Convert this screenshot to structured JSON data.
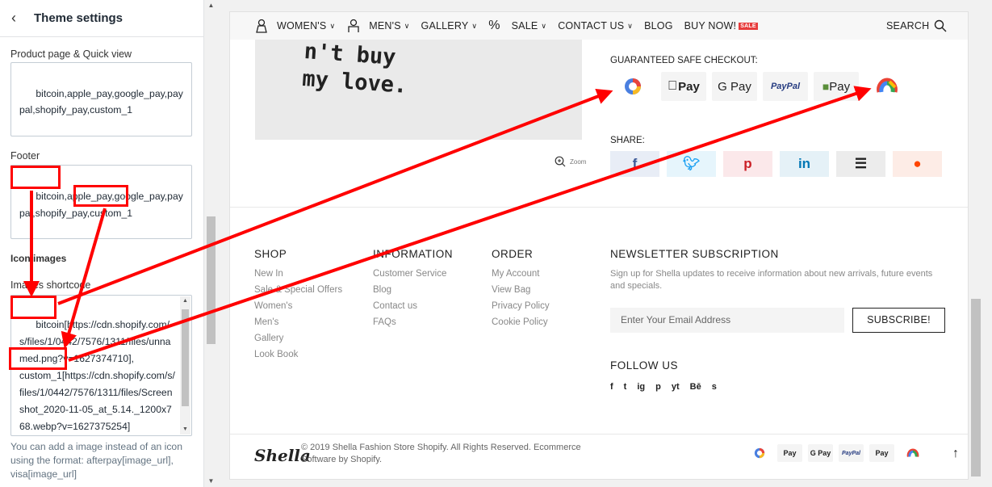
{
  "panel": {
    "back_icon": "chevron-left-icon",
    "title": "Theme settings",
    "product_label": "Product page & Quick view",
    "product_value": "bitcoin,apple_pay,google_pay,paypal,shopify_pay,custom_1",
    "footer_label": "Footer",
    "footer_value": "bitcoin,apple_pay,google_pay,paypal,shopify_pay,custom_1",
    "icon_images_label": "Icon images",
    "shortcode_label": "Images shortcode",
    "shortcode_value": "bitcoin[https://cdn.shopify.com/s/files/1/0442/7576/1311/files/unnamed.png?v=1627374710],\ncustom_1[https://cdn.shopify.com/s/files/1/0442/7576/1311/files/Screenshot_2020-11-05_at_5.14._1200x768.webp?v=1627375254]",
    "help_text": "You can add a image instead of an icon using the format: afterpay[image_url], visa[image_url]"
  },
  "nav": {
    "items": [
      "WOMEN'S",
      "MEN'S",
      "GALLERY",
      "SALE",
      "CONTACT US",
      "BLOG",
      "BUY NOW!"
    ],
    "sale_badge": "SALE",
    "search_label": "SEARCH"
  },
  "product": {
    "shirt_text": "n't buy\nmy love.",
    "zoom_label": "Zoom",
    "checkout_label": "GUARANTEED SAFE CHECKOUT:",
    "pay_icons": [
      "custom-bitcoin-icon",
      "apple-pay",
      "google-pay",
      "paypal",
      "shopify-pay",
      "custom-1-icon"
    ],
    "apple_pay": "Pay",
    "google_pay": "G Pay",
    "paypal": "PayPal",
    "shopify_pay": "Pay",
    "share_label": "SHARE:",
    "share_icons": [
      "facebook-icon",
      "twitter-icon",
      "pinterest-icon",
      "linkedin-icon",
      "buffer-icon",
      "reddit-icon"
    ]
  },
  "footer": {
    "shop_title": "SHOP",
    "shop_links": [
      "New In",
      "Sale & Special Offers",
      "Women's",
      "Men's",
      "Gallery",
      "Look Book"
    ],
    "info_title": "INFORMATION",
    "info_links": [
      "Customer Service",
      "Blog",
      "Contact us",
      "FAQs"
    ],
    "order_title": "ORDER",
    "order_links": [
      "My Account",
      "View Bag",
      "Privacy Policy",
      "Cookie Policy"
    ],
    "newsletter_title": "NEWSLETTER SUBSCRIPTION",
    "newsletter_text": "Sign up for Shella updates to receive information about new arrivals, future events and specials.",
    "email_placeholder": "Enter Your Email Address",
    "subscribe_label": "SUBSCRIBE!",
    "follow_title": "FOLLOW US",
    "social": [
      "f",
      "t",
      "ig",
      "p",
      "yt",
      "Bē",
      "s"
    ],
    "logo": "Shella",
    "copyright": "© 2019 Shella Fashion Store Shopify. All Rights Reserved. Ecommerce Software by Shopify.",
    "bottom_pay": [
      "Pay",
      "G Pay",
      "PayPal",
      "Pay"
    ]
  },
  "colors": {
    "annotation": "#ff0000",
    "sale_badge": "#e73c3c"
  }
}
